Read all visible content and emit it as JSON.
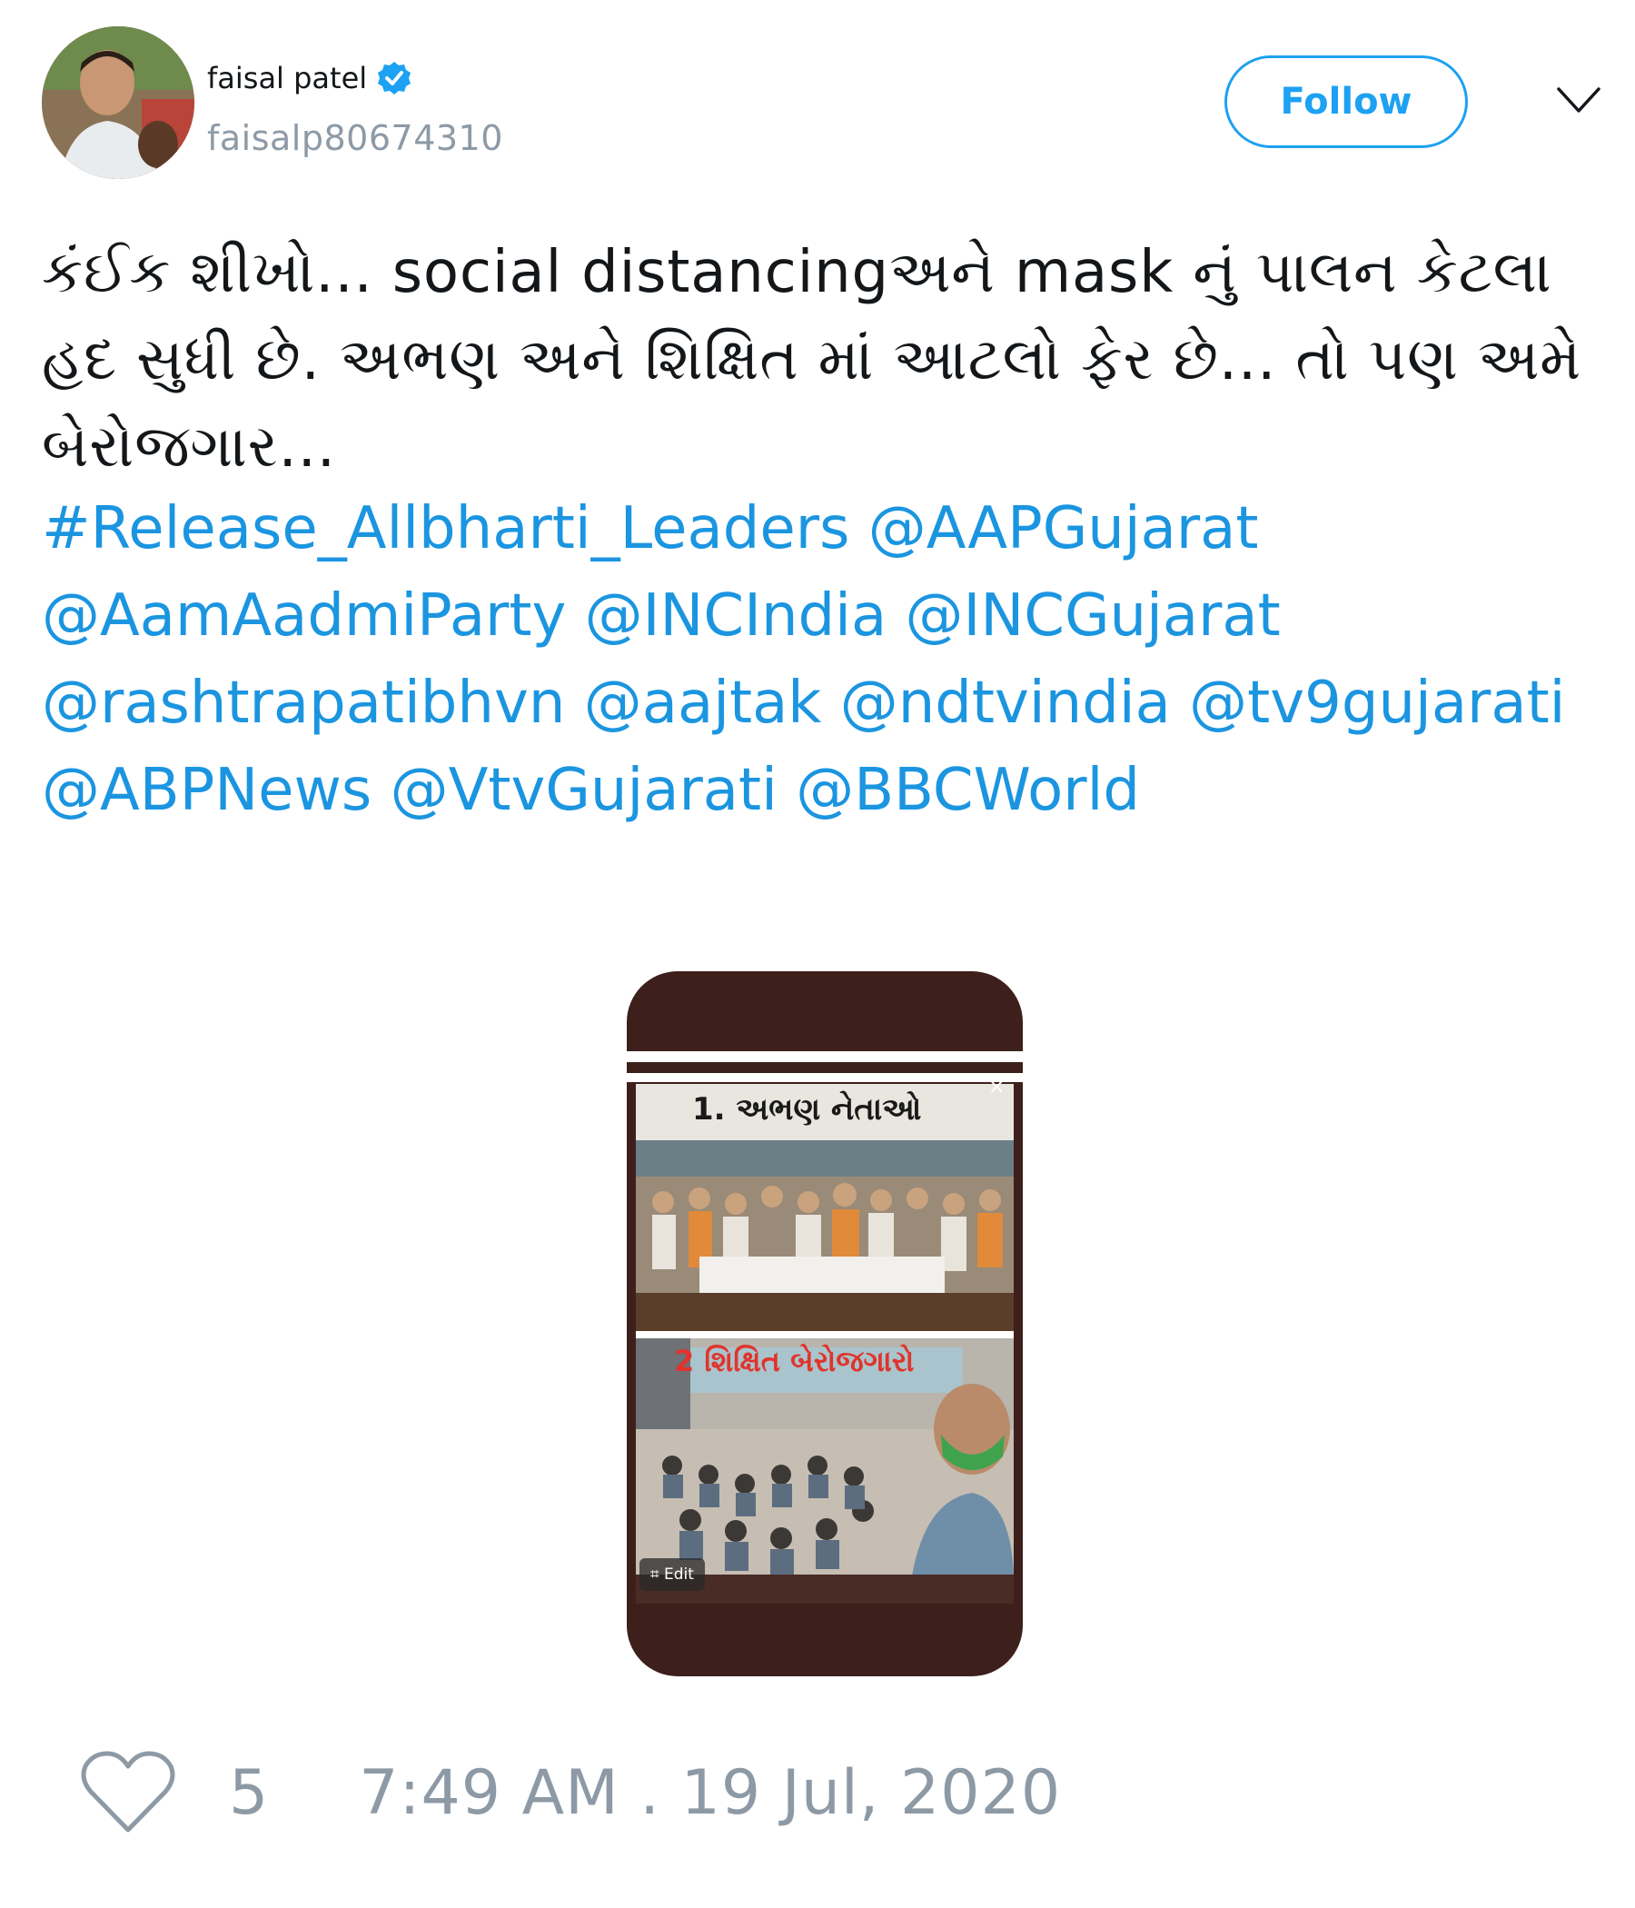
{
  "author": {
    "display_name": "faisal patel",
    "handle": "faisalp80674310",
    "verified": true
  },
  "header": {
    "follow_label": "Follow"
  },
  "tweet": {
    "text": "કંઈક શીખો... social distancingઅને mask નું પાલન કેટલા હદ સુધી છે. અભણ અને શિક્ષિત માં આટલો ફેર છે... તો પણ અમે બેરોજગાર...",
    "tags": [
      "#Release_Allbharti_Leaders",
      "@AAPGujarat",
      "@AamAadmiParty",
      "@INCIndia",
      "@INCGujarat",
      "@rashtrapatibhvn",
      "@aajtak",
      "@ndtvindia",
      "@tv9gujarati",
      "@ABPNews",
      "@VtvGujarati",
      "@BBCWorld"
    ]
  },
  "media": {
    "caption_top": "1. અભણ નેતાઓ",
    "caption_bottom": "2 શિક્ષિત બેરોજગારો",
    "edit_label": "Edit"
  },
  "footer": {
    "like_count": "5",
    "timestamp": "7:49 AM . 19 Jul, 2020"
  },
  "colors": {
    "accent": "#1da1f2",
    "link": "#1b95e0",
    "muted": "#8d9aa6",
    "media_frame": "#3d1f1b"
  },
  "icons": {
    "verified": "verified-badge-icon",
    "chevron": "chevron-down-icon",
    "like": "heart-icon"
  }
}
